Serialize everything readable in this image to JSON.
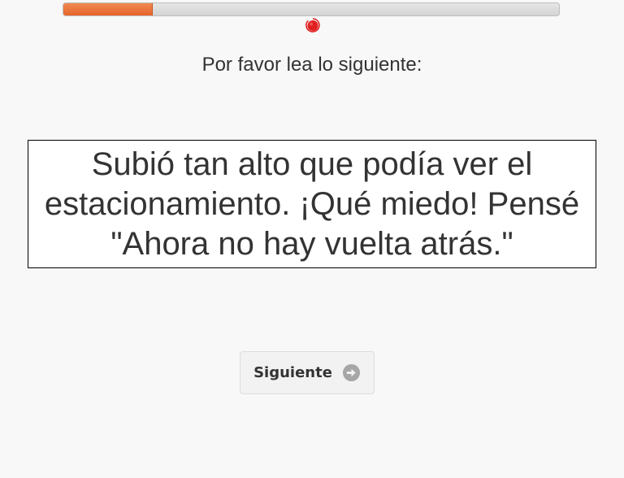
{
  "progress": {
    "fraction": 0.18,
    "fill_color": "#e5652a",
    "track_color": "#d9d9d9"
  },
  "recording_indicator": {
    "icon": "record-icon",
    "color": "#e02020"
  },
  "instruction": {
    "text": "Por favor lea lo siguiente:"
  },
  "reading": {
    "text": "Subió tan alto que podía ver el estacionamiento. ¡Qué miedo! Pensé \"Ahora no hay vuelta atrás.\""
  },
  "next_button": {
    "label": "Siguiente",
    "icon": "arrow-right-circle-icon",
    "icon_color": "#a6a6a6"
  }
}
